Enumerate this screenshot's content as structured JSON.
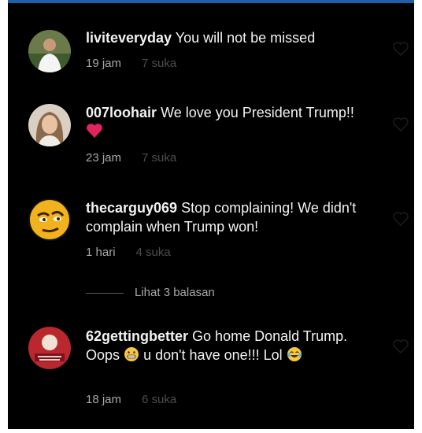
{
  "comments": [
    {
      "username": "liviteveryday",
      "text": "You will not be missed",
      "time": "19 jam",
      "likes": "7 suka"
    },
    {
      "username": "007loohair",
      "text": "We love you President Trump!!",
      "emoji": "❤️",
      "time": "23 jam",
      "likes": "7 suka"
    },
    {
      "username": "thecarguy069",
      "text": "Stop complaining! We didn't complain when Trump won!",
      "time": "1 hari",
      "likes": "4 suka"
    },
    {
      "username": "62gettingbetter",
      "text_before": "Go home Donald Trump. Oops",
      "emoji_1": "😬",
      "text_after": "u don't have one!!! Lol",
      "emoji_2": "😂",
      "time": "18 jam",
      "likes": "6 suka"
    }
  ],
  "replies_label": "Lihat 3 balasan",
  "colors": {
    "background": "#000000",
    "text": "#f2f2f2",
    "meta": "#a8a8a8",
    "heart": "#e0245e"
  }
}
